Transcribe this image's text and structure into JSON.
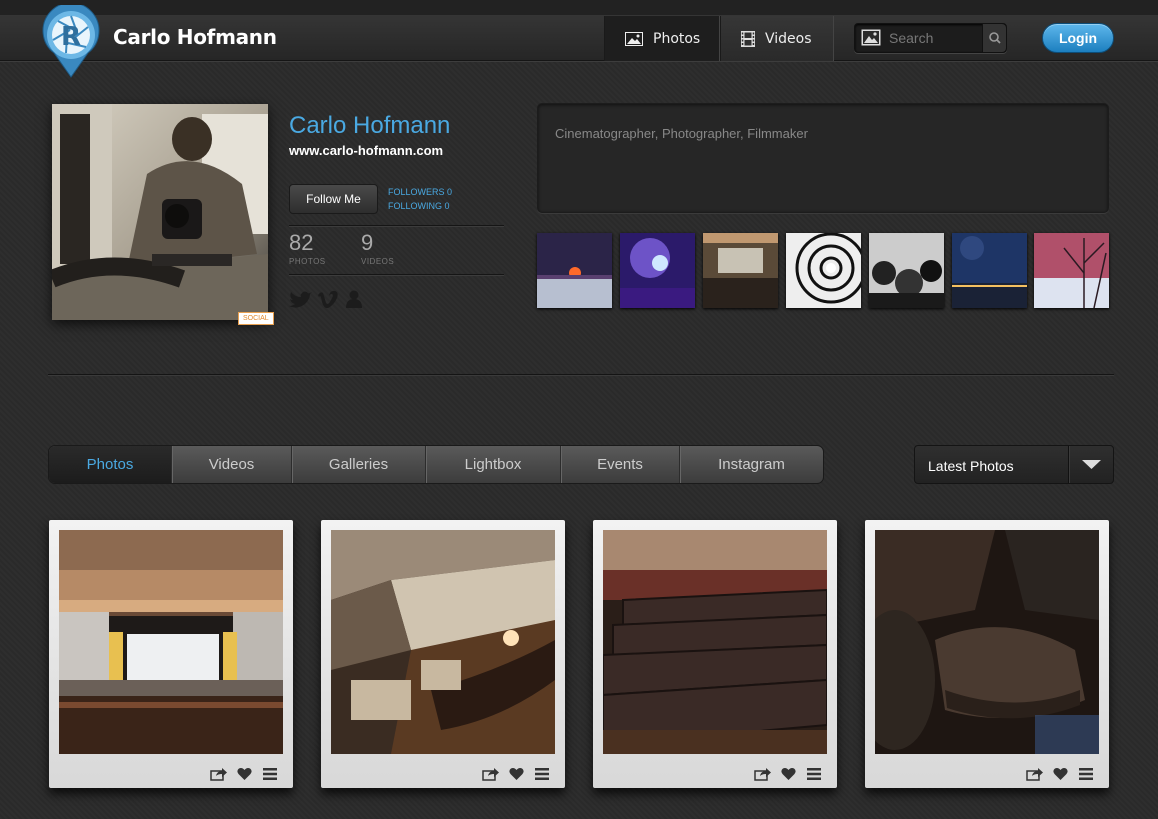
{
  "header": {
    "brand": "Carlo Hofmann",
    "nav": [
      {
        "label": "Photos",
        "active": true
      },
      {
        "label": "Videos",
        "active": false
      }
    ],
    "search_placeholder": "Search",
    "login_label": "Login"
  },
  "profile": {
    "name": "Carlo Hofmann",
    "website": "www.carlo-hofmann.com",
    "follow_label": "Follow Me",
    "followers": "FOLLOWERS 0",
    "following": "FOLLOWING 0",
    "photos_count": "82",
    "photos_label": "PHOTOS",
    "videos_count": "9",
    "videos_label": "VIDEOS",
    "social_tag": "SOCIAL",
    "social_icons": [
      "twitter-icon",
      "vimeo-icon",
      "profile-icon"
    ],
    "bio": "Cinematographer, Photographer, Filmmaker"
  },
  "tabs": [
    {
      "label": "Photos",
      "active": true
    },
    {
      "label": "Videos",
      "active": false
    },
    {
      "label": "Galleries",
      "active": false
    },
    {
      "label": "Lightbox",
      "active": false
    },
    {
      "label": "Events",
      "active": false
    },
    {
      "label": "Instagram",
      "active": false
    }
  ],
  "sort": {
    "selected": "Latest Photos"
  },
  "colors": {
    "accent": "#4aa9e2",
    "login": "#1c7fbf",
    "background": "#2b2b2b"
  }
}
